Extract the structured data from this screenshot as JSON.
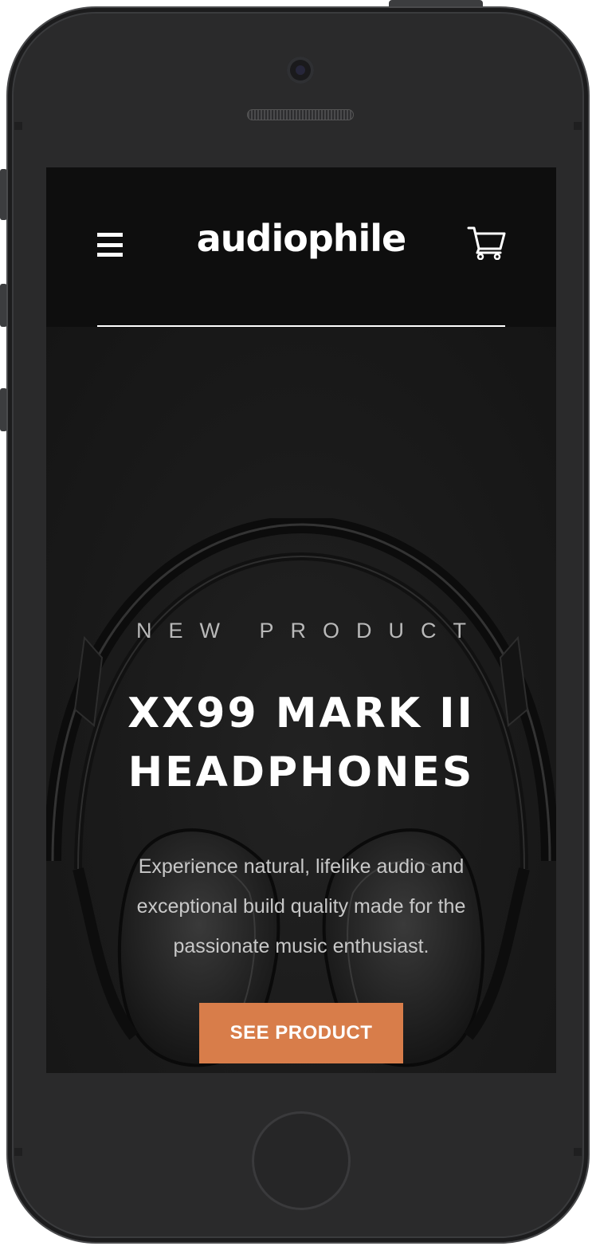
{
  "header": {
    "menu_icon": "hamburger-menu-icon",
    "logo_text": "audiophile",
    "cart_icon": "shopping-cart-icon"
  },
  "hero": {
    "overline": "NEW PRODUCT",
    "title_line1": "XX99 MARK II",
    "title_line2": "HEADPHONES",
    "description": "Experience natural, lifelike audio and exceptional build quality made for the passionate music enthusiast.",
    "cta_label": "SEE PRODUCT"
  },
  "colors": {
    "accent": "#D87D4A",
    "header_bg": "#0E0E0E",
    "hero_bg": "#191919",
    "text_primary": "#FFFFFF"
  }
}
